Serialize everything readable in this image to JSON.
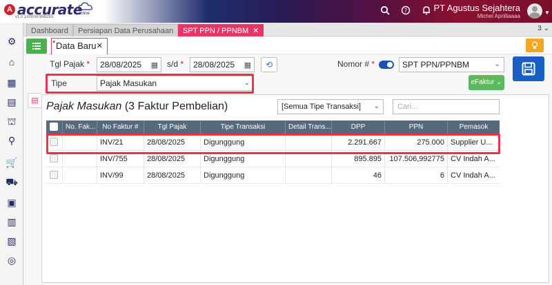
{
  "app": {
    "logo_letter": "A",
    "logo_text": "accurate",
    "logo_sub": "online",
    "version": "v1.0.1#0000-998293",
    "company": "PT Agustus Sejahtera",
    "user": "Michel Aprilliaaaa"
  },
  "tabs": [
    {
      "label": "Dashboard"
    },
    {
      "label": "Persiapan Data Perusahaan"
    },
    {
      "label": "SPT PPN / PPNBM",
      "close": "✕"
    }
  ],
  "tab_count": "3 ⌄",
  "doc_tab": {
    "star": "*",
    "label": "Data Baru",
    "close": "✕"
  },
  "form": {
    "tgl_pajak_label": "Tgl Pajak",
    "req": "*",
    "tgl_pajak_from": "28/08/2025",
    "sd_label": "s/d",
    "tgl_pajak_to": "28/08/2025",
    "nomor_label": "Nomor #",
    "nomor_value": "SPT PPN/PPNBM",
    "tipe_label": "Tipe",
    "tipe_value": "Pajak Masukan",
    "efaktur_label": "eFaktur ⌄"
  },
  "panel": {
    "title_italic": "Pajak Masukan",
    "title_rest": " (3 Faktur Pembelian)",
    "filter_value": "[Semua Tipe Transaksi]",
    "search_placeholder": "Cari..."
  },
  "table": {
    "columns": [
      "No. Fak...",
      "No Faktur #",
      "Tgl Pajak",
      "Tipe Transaksi",
      "Detail Trans...",
      "DPP",
      "PPN",
      "Pemasok"
    ],
    "rows": [
      {
        "no_fak": "",
        "no_faktur": "INV/21",
        "tgl": "28/08/2025",
        "tipe": "Digunggung",
        "detail": "",
        "dpp": "2.291.667",
        "ppn": "275.000",
        "pemasok": "Supplier U..."
      },
      {
        "no_fak": "",
        "no_faktur": "INV/755",
        "tgl": "28/08/2025",
        "tipe": "Digunggung",
        "detail": "",
        "dpp": "895.895",
        "ppn": "107.506,992775",
        "pemasok": "CV Indah A..."
      },
      {
        "no_fak": "",
        "no_faktur": "INV/99",
        "tgl": "28/08/2025",
        "tipe": "Digunggung",
        "detail": "",
        "dpp": "46",
        "ppn": "6",
        "pemasok": "CV Indah A..."
      }
    ]
  },
  "colors": {
    "accent": "#e9346a",
    "primary": "#1a5fc4",
    "green": "#5cb85c",
    "highlight": "#e8344a",
    "grid_header": "#556a7c"
  }
}
